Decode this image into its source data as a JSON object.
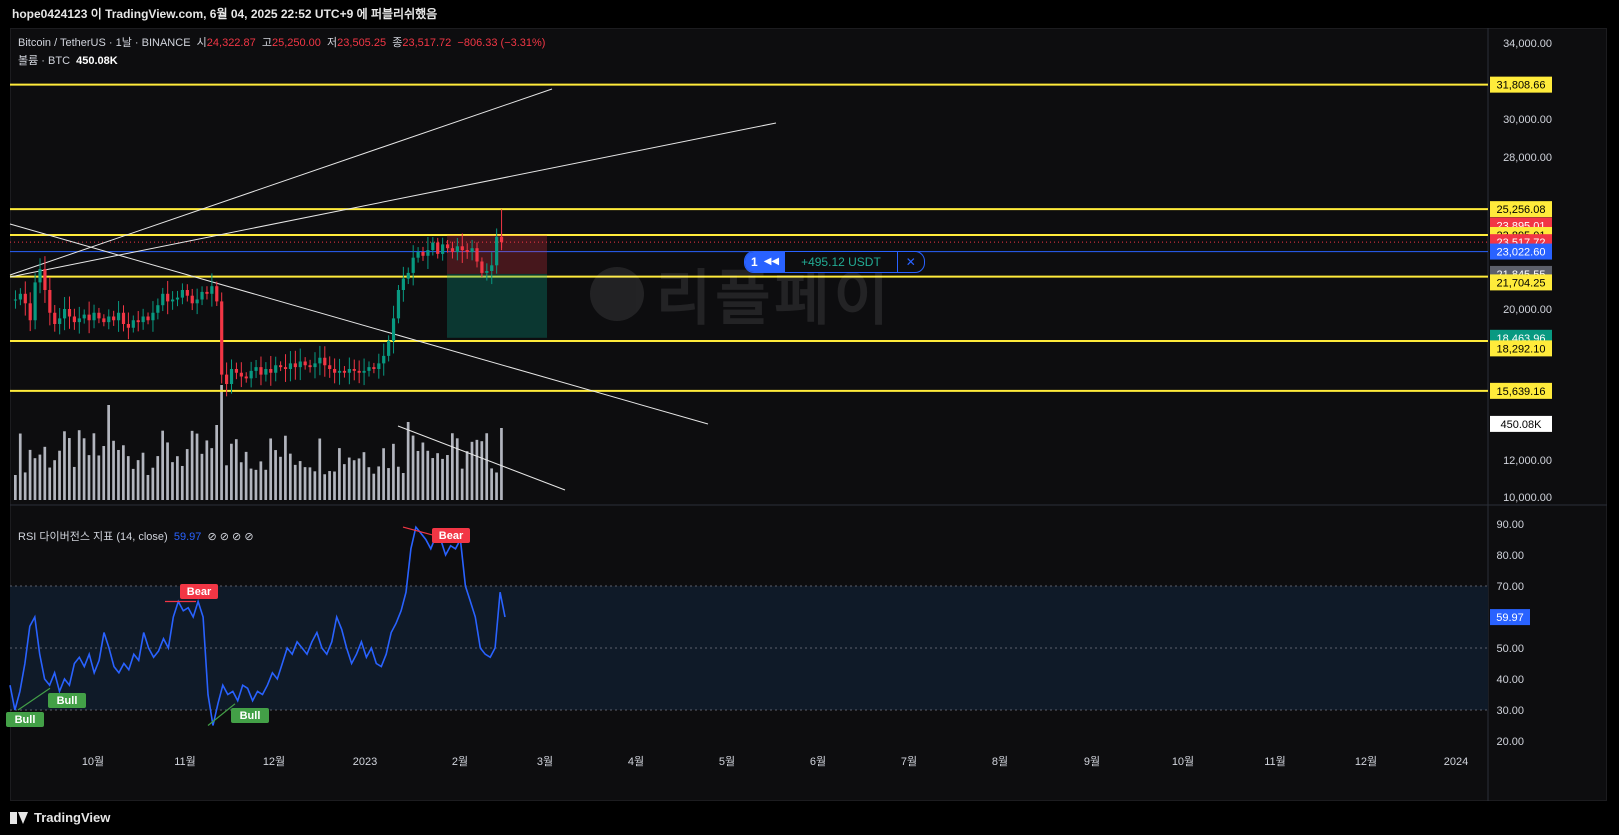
{
  "header": {
    "title": "hope0424123 이 TradingView.com, 6월 04, 2025 22:52 UTC+9 에 퍼블리쉬했음"
  },
  "legend": {
    "symbol": "Bitcoin / TetherUS · 1날 · BINANCE",
    "open_label": "시",
    "open": "24,322.87",
    "high_label": "고",
    "high": "25,250.00",
    "low_label": "저",
    "low": "23,505.25",
    "close_label": "종",
    "close": "23,517.72",
    "change": "−806.33 (−3.31%)",
    "volume_label": "볼륨 · BTC",
    "volume": "450.08K"
  },
  "rsi_legend": {
    "name": "RSI 다이버전스 지표 (14, close)",
    "value": "59.97",
    "icons": [
      "⊘",
      "⊘",
      "⊘",
      "⊘"
    ]
  },
  "position_widget": {
    "qty": "1",
    "pnl": "+495.12 USDT",
    "close": "✕"
  },
  "watermark": {
    "text": "리플페이"
  },
  "footer": {
    "brand": "TradingView"
  },
  "chart_data": [
    {
      "type": "candlestick",
      "y_ticks": [
        "34,000.00",
        "30,000.00",
        "28,000.00",
        "20,000.00",
        "12,000.00",
        "10,000.00"
      ],
      "x_ticks": [
        "10월",
        "11월",
        "12월",
        "2023",
        "2월",
        "3월",
        "4월",
        "5월",
        "6월",
        "7월",
        "8월",
        "9월",
        "10월",
        "11월",
        "12월",
        "2024"
      ],
      "horizontal_levels": [
        31808.66,
        25256.08,
        23895.01,
        21704.25,
        18292.1,
        15639.16
      ],
      "price_labels": [
        {
          "text": "31,808.66",
          "color": "#ffeb3b",
          "value": 31808.66
        },
        {
          "text": "25,256.08",
          "color": "#ffeb3b",
          "value": 25256.08
        },
        {
          "text": "23,895.01",
          "color": "#f23645",
          "value": 24400
        },
        {
          "text": "23,895.01",
          "color": "#ffeb3b",
          "value": 23895.01
        },
        {
          "text": "23,517.72",
          "color": "#f23645",
          "value": 23517.72
        },
        {
          "text": "23,022.60",
          "color": "#2962ff",
          "value": 23022.6
        },
        {
          "text": "21,845.55",
          "color": "#5d606b",
          "value": 21845.55
        },
        {
          "text": "21,704.25",
          "color": "#ffeb3b",
          "value": 21400
        },
        {
          "text": "18,463.96",
          "color": "#089981",
          "value": 18463.96
        },
        {
          "text": "18,292.10",
          "color": "#ffeb3b",
          "value": 17900
        },
        {
          "text": "15,639.16",
          "color": "#ffeb3b",
          "value": 15639.16
        },
        {
          "text": "450.08K",
          "color": "#ffffff",
          "value": 13900
        }
      ],
      "ohlc_path": [
        20500,
        20800,
        20300,
        19400,
        21400,
        22100,
        21000,
        19800,
        19200,
        19500,
        20000,
        19600,
        19300,
        19500,
        19700,
        19400,
        19800,
        19500,
        19300,
        19600,
        19400,
        19800,
        19200,
        19000,
        19400,
        19300,
        19600,
        19400,
        19800,
        20200,
        20800,
        20400,
        20500,
        20600,
        21000,
        20700,
        20300,
        20500,
        20900,
        20800,
        21200,
        20400,
        16500,
        16000,
        16800,
        16600,
        16400,
        16300,
        16700,
        16900,
        16500,
        16800,
        16600,
        17000,
        16900,
        16800,
        17100,
        16900,
        17200,
        17000,
        16900,
        17100,
        17400,
        17000,
        16800,
        16600,
        16700,
        16600,
        16800,
        16700,
        16600,
        16700,
        16900,
        16800,
        17100,
        17500,
        18300,
        19500,
        21000,
        21600,
        21900,
        22700,
        23000,
        22800,
        23100,
        23500,
        22900,
        23400,
        23200,
        23000,
        23300,
        23100,
        23000,
        23200,
        22500,
        21900,
        22000,
        22300,
        23800,
        23517
      ]
    },
    {
      "type": "line",
      "name": "RSI",
      "y_ticks": [
        "90.00",
        "80.00",
        "70.00",
        "50.00",
        "40.00",
        "30.00",
        "20.00"
      ],
      "ylim": [
        20,
        90
      ],
      "overbought": 70,
      "oversold": 30,
      "midline": 50,
      "values": [
        38,
        30,
        36,
        45,
        57,
        60,
        48,
        40,
        38,
        42,
        36,
        40,
        38,
        45,
        47,
        44,
        48,
        42,
        46,
        55,
        50,
        44,
        42,
        45,
        43,
        48,
        46,
        55,
        50,
        47,
        49,
        53,
        50,
        60,
        65,
        62,
        63,
        60,
        65,
        60,
        35,
        25,
        32,
        38,
        35,
        36,
        33,
        38,
        37,
        33,
        36,
        35,
        38,
        42,
        40,
        45,
        50,
        48,
        52,
        50,
        48,
        52,
        55,
        50,
        48,
        52,
        60,
        56,
        50,
        45,
        48,
        52,
        47,
        50,
        45,
        44,
        48,
        55,
        58,
        62,
        68,
        82,
        89,
        87,
        85,
        82,
        86,
        85,
        80,
        83,
        82,
        85,
        70,
        65,
        60,
        50,
        48,
        47,
        50,
        68,
        60
      ],
      "divergence_labels": [
        {
          "text": "Bull",
          "color": "#43a047"
        },
        {
          "text": "Bull",
          "color": "#43a047"
        },
        {
          "text": "Bull",
          "color": "#43a047"
        },
        {
          "text": "Bear",
          "color": "#f23645"
        },
        {
          "text": "Bear",
          "color": "#f23645"
        }
      ],
      "current_label": "59.97"
    }
  ],
  "colors": {
    "up": "#089981",
    "down": "#f23645",
    "level": "#ffeb3b",
    "rsi": "#2962ff",
    "volume": "#b2b5be"
  }
}
